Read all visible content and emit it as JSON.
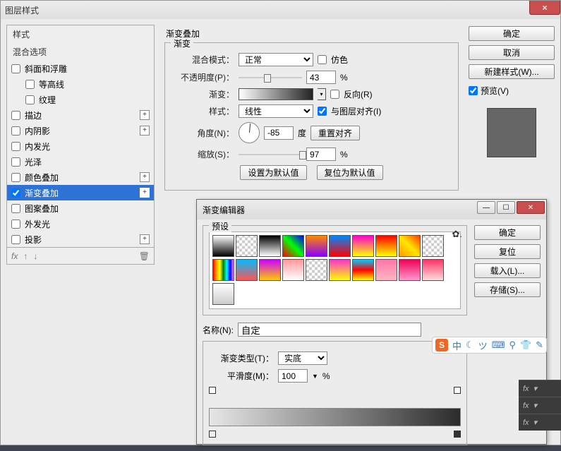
{
  "main_window": {
    "title": "图层样式",
    "close_icon": "×",
    "sidebar": {
      "header1": "样式",
      "header2": "混合选项",
      "items": [
        {
          "label": "斜面和浮雕",
          "checked": false,
          "plus": false
        },
        {
          "label": "等高线",
          "checked": false,
          "indent": true
        },
        {
          "label": "纹理",
          "checked": false,
          "indent": true
        },
        {
          "label": "描边",
          "checked": false,
          "plus": true
        },
        {
          "label": "内阴影",
          "checked": false,
          "plus": true
        },
        {
          "label": "内发光",
          "checked": false
        },
        {
          "label": "光泽",
          "checked": false
        },
        {
          "label": "颜色叠加",
          "checked": false,
          "plus": true
        },
        {
          "label": "渐变叠加",
          "checked": true,
          "plus": true,
          "selected": true
        },
        {
          "label": "图案叠加",
          "checked": false
        },
        {
          "label": "外发光",
          "checked": false
        },
        {
          "label": "投影",
          "checked": false,
          "plus": true
        }
      ],
      "footer_fx": "fx"
    },
    "center": {
      "section_title": "渐变叠加",
      "group_title": "渐变",
      "rows": {
        "blend_label": "混合模式：",
        "blend_value": "正常",
        "dither_label": "仿色",
        "opacity_label": "不透明度(P)：",
        "opacity_value": "43",
        "percent": "%",
        "gradient_label": "渐变：",
        "reverse_label": "反向(R)",
        "style_label": "样式：",
        "style_value": "线性",
        "align_label": "与图层对齐(I)",
        "angle_label": "角度(N)：",
        "angle_value": "-85",
        "degree": "度",
        "reset_align": "重置对齐",
        "scale_label": "缩放(S)：",
        "scale_value": "97",
        "make_default": "设置为默认值",
        "reset_default": "复位为默认值"
      }
    },
    "right": {
      "ok": "确定",
      "cancel": "取消",
      "new_style": "新建样式(W)...",
      "preview_label": "预览(V)"
    }
  },
  "gradient_editor": {
    "title": "渐变编辑器",
    "presets_title": "预设",
    "ok": "确定",
    "reset": "复位",
    "load": "载入(L)...",
    "save": "存储(S)...",
    "name_label": "名称(N):",
    "name_value": "自定",
    "gtype_label": "渐变类型(T)：",
    "gtype_value": "实底",
    "smooth_label": "平滑度(M)：",
    "smooth_value": "100",
    "percent": "%",
    "swatches": [
      "linear-gradient(#fff,#000)",
      "repeating-conic-gradient(#ccc 0 25%,#fff 0 50%) 0/8px 8px",
      "linear-gradient(#000,#fff)",
      "linear-gradient(45deg,#f00,#0f0,#00f)",
      "linear-gradient(#f80,#80f)",
      "linear-gradient(#08f,#f00)",
      "linear-gradient(#f0c,#ff0)",
      "linear-gradient(#f00,#ff0)",
      "linear-gradient(45deg,#ff9a00,#ffe600,#ff3c00)",
      "repeating-conic-gradient(#ccc 0 25%,#fff 0 50%) 0/8px 8px",
      "linear-gradient(90deg,red,orange,yellow,green,cyan,blue,violet)",
      "linear-gradient(#0bf,#f55)",
      "linear-gradient(#c0f,#fc0)",
      "linear-gradient(#f99,#fff)",
      "repeating-conic-gradient(#ccc 0 25%,#fff 0 50%) 0/8px 8px",
      "linear-gradient(#f3c,#ff0)",
      "linear-gradient(#0cf,#f00,#ff0)",
      "linear-gradient(#f7a,#ffb6c1)",
      "linear-gradient(#e05,#f9c)",
      "linear-gradient(#f36,#fdd)",
      "linear-gradient(#fff,#ccc)"
    ]
  },
  "ime": {
    "logo": "S",
    "items": [
      "中",
      "☾",
      "ツ",
      "⌨",
      "⚲",
      "👕",
      "✎"
    ]
  },
  "fx_label": "fx"
}
